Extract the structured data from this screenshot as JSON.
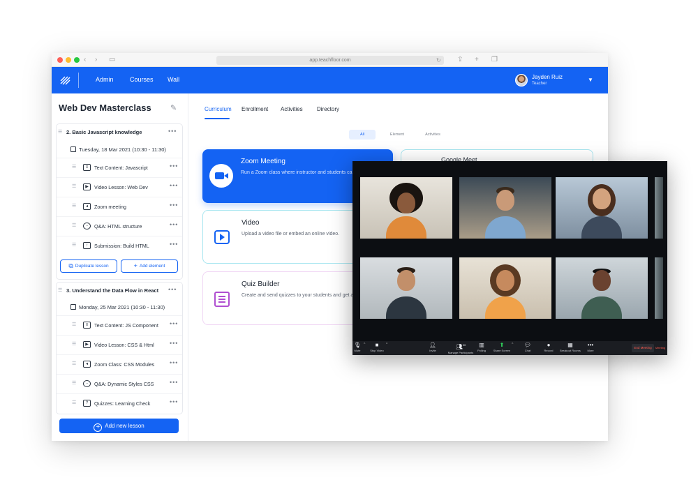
{
  "browser": {
    "url": "app.teachfloor.com"
  },
  "nav": {
    "links": [
      "Admin",
      "Courses",
      "Wall"
    ],
    "user_name": "Jayden Ruiz",
    "user_role": "Teacher"
  },
  "sidebar": {
    "course_title": "Web Dev Masterclass",
    "sections": [
      {
        "title": "2. Basic Javascript knowledge",
        "date": "Tuesday, 18 Mar 2021 (10:30 - 11:30)",
        "items": [
          {
            "icon": "text-content-icon",
            "label": "Text Content: Javascript"
          },
          {
            "icon": "video-lesson-icon",
            "label": "Video Lesson: Web Dev"
          },
          {
            "icon": "zoom-camera-icon",
            "label": "Zoom meeting"
          },
          {
            "icon": "qa-bubble-icon",
            "label": "Q&A: HTML structure"
          },
          {
            "icon": "submission-icon",
            "label": "Submission: Build HTML"
          }
        ],
        "duplicate_label": "Duplicate lesson",
        "add_element_label": "Add element"
      },
      {
        "title": "3. Understand the Data Flow in React",
        "date": "Monday, 25 Mar 2021 (10:30 - 11:30)",
        "items": [
          {
            "icon": "text-content-icon",
            "label": "Text Content: JS Component"
          },
          {
            "icon": "video-lesson-icon",
            "label": "Video Lesson: CSS & Html"
          },
          {
            "icon": "zoom-camera-icon",
            "label": "Zoom Class: CSS Modules"
          },
          {
            "icon": "qa-bubble-icon",
            "label": "Q&A: Dynamic Styles CSS"
          },
          {
            "icon": "quiz-icon",
            "label": "Quizzes: Learning Check"
          }
        ]
      }
    ],
    "add_lesson_label": "Add new lesson"
  },
  "main": {
    "tabs": [
      "Curriculum",
      "Enrollment",
      "Activities",
      "Directory"
    ],
    "active_tab": "Curriculum",
    "filters": [
      "All",
      "Element",
      "Activities"
    ],
    "cards": [
      {
        "title": "Zoom Meeting",
        "desc": "Run a Zoom class where instructor and students can participate."
      },
      {
        "title": "Video",
        "desc": "Upload a video file or embed an online video."
      },
      {
        "title": "Quiz Builder",
        "desc": "Create and send quizzes to your students and get answers"
      }
    ],
    "right_card_title": "Google Meet"
  },
  "zoom": {
    "toolbar": [
      "Mute",
      "Stop Video",
      "Invite",
      "Manage Participants",
      "Polling",
      "Share Screen",
      "Chat",
      "Record",
      "Breakout Rooms",
      "More"
    ],
    "participant_count": "20",
    "end_label": "End Meeting",
    "end_label_2": "Meeting"
  },
  "colors": {
    "brand": "#1463f3",
    "zoom_bg": "#0c0e12"
  }
}
